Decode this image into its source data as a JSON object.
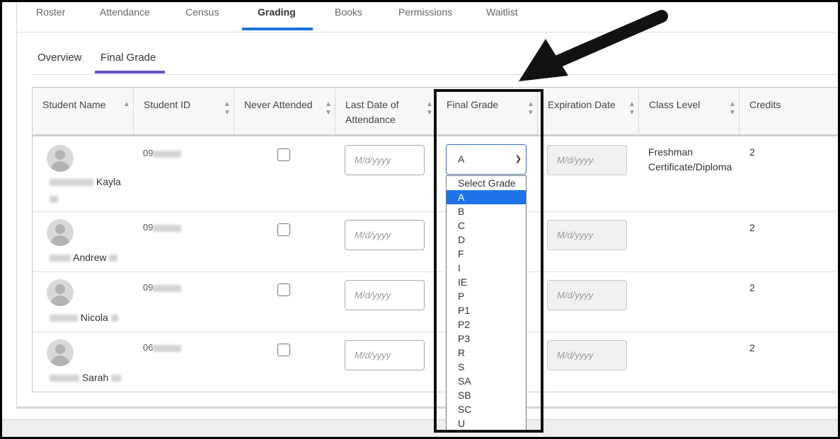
{
  "tabs": {
    "items": [
      "Roster",
      "Attendance",
      "Census",
      "Grading",
      "Books",
      "Permissions",
      "Waitlist"
    ],
    "active": "Grading"
  },
  "subtabs": {
    "items": [
      "Overview",
      "Final Grade"
    ],
    "active": "Final Grade"
  },
  "table": {
    "columns": [
      "Student Name",
      "Student ID",
      "Never Attended",
      "Last Date of Attendance",
      "Final Grade",
      "Expiration Date",
      "Class Level",
      "Credits"
    ],
    "date_placeholder": "M/d/yyyy",
    "rows": [
      {
        "name": "Kayla",
        "id_prefix": "09",
        "class_level": "Freshman Certificate/Diploma",
        "credits": "2",
        "grade": "A"
      },
      {
        "name": "Andrew",
        "id_prefix": "09",
        "class_level": "",
        "credits": "2"
      },
      {
        "name": "Nicola",
        "id_prefix": "09",
        "class_level": "",
        "credits": "2"
      },
      {
        "name": "Sarah",
        "id_prefix": "06",
        "class_level": "",
        "credits": "2"
      }
    ]
  },
  "grade_dropdown": {
    "selected": "A",
    "options": [
      "Select Grade",
      "A",
      "B",
      "C",
      "D",
      "F",
      "I",
      "IE",
      "P",
      "P1",
      "P2",
      "P3",
      "R",
      "S",
      "SA",
      "SB",
      "SC",
      "U"
    ]
  },
  "colors": {
    "top_tab_underline": "#1a73d9",
    "sub_tab_underline": "#6a4fc4",
    "option_highlight": "#1e73e8",
    "annotation": "#111111"
  },
  "icons": {
    "sort": "up-down-chevron-icon",
    "avatar": "user-placeholder-icon",
    "select_caret": "chevron-down-icon",
    "annotation": "arrow-icon"
  }
}
